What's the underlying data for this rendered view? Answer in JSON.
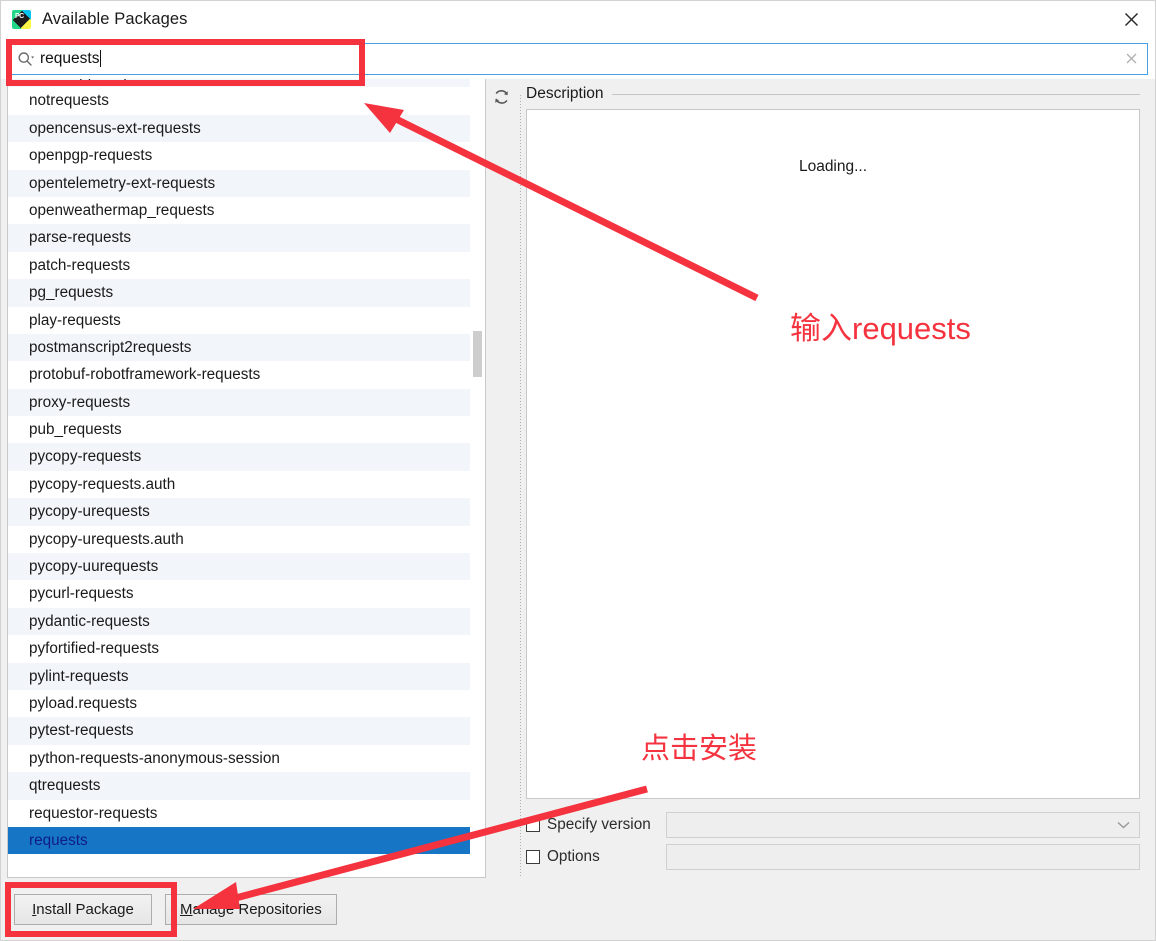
{
  "window": {
    "title": "Available Packages",
    "app_icon": "pycharm-icon",
    "icon_text": "PC",
    "close_icon": "close-icon"
  },
  "search": {
    "icon": "search-icon",
    "value": "requests",
    "placeholder": "",
    "clear_icon": "clear-icon"
  },
  "toolbar": {
    "refresh_icon": "refresh-icon"
  },
  "package_list": {
    "selected": "requests",
    "items": [
      "nosedapp_requests",
      "notrequests",
      "opencensus-ext-requests",
      "openpgp-requests",
      "opentelemetry-ext-requests",
      "openweathermap_requests",
      "parse-requests",
      "patch-requests",
      "pg_requests",
      "play-requests",
      "postmanscript2requests",
      "protobuf-robotframework-requests",
      "proxy-requests",
      "pub_requests",
      "pycopy-requests",
      "pycopy-requests.auth",
      "pycopy-urequests",
      "pycopy-urequests.auth",
      "pycopy-uurequests",
      "pycurl-requests",
      "pydantic-requests",
      "pyfortified-requests",
      "pylint-requests",
      "pyload.requests",
      "pytest-requests",
      "python-requests-anonymous-session",
      "qtrequests",
      "requestor-requests",
      "requests"
    ]
  },
  "description": {
    "title": "Description",
    "body": "Loading..."
  },
  "options": {
    "specify_version": {
      "label": "Specify version",
      "checked": false,
      "value": "",
      "dropdown_icon": "chevron-down-icon"
    },
    "options_flag": {
      "label": "Options",
      "checked": false,
      "value": ""
    }
  },
  "footer": {
    "install": {
      "mnemonic": "I",
      "rest": "nstall Package"
    },
    "manage": {
      "mnemonic": "M",
      "rest": "anage Repositories"
    }
  },
  "annotations": {
    "color": "#f5333f",
    "note_search": "输入requests",
    "note_install": "点击安装"
  }
}
